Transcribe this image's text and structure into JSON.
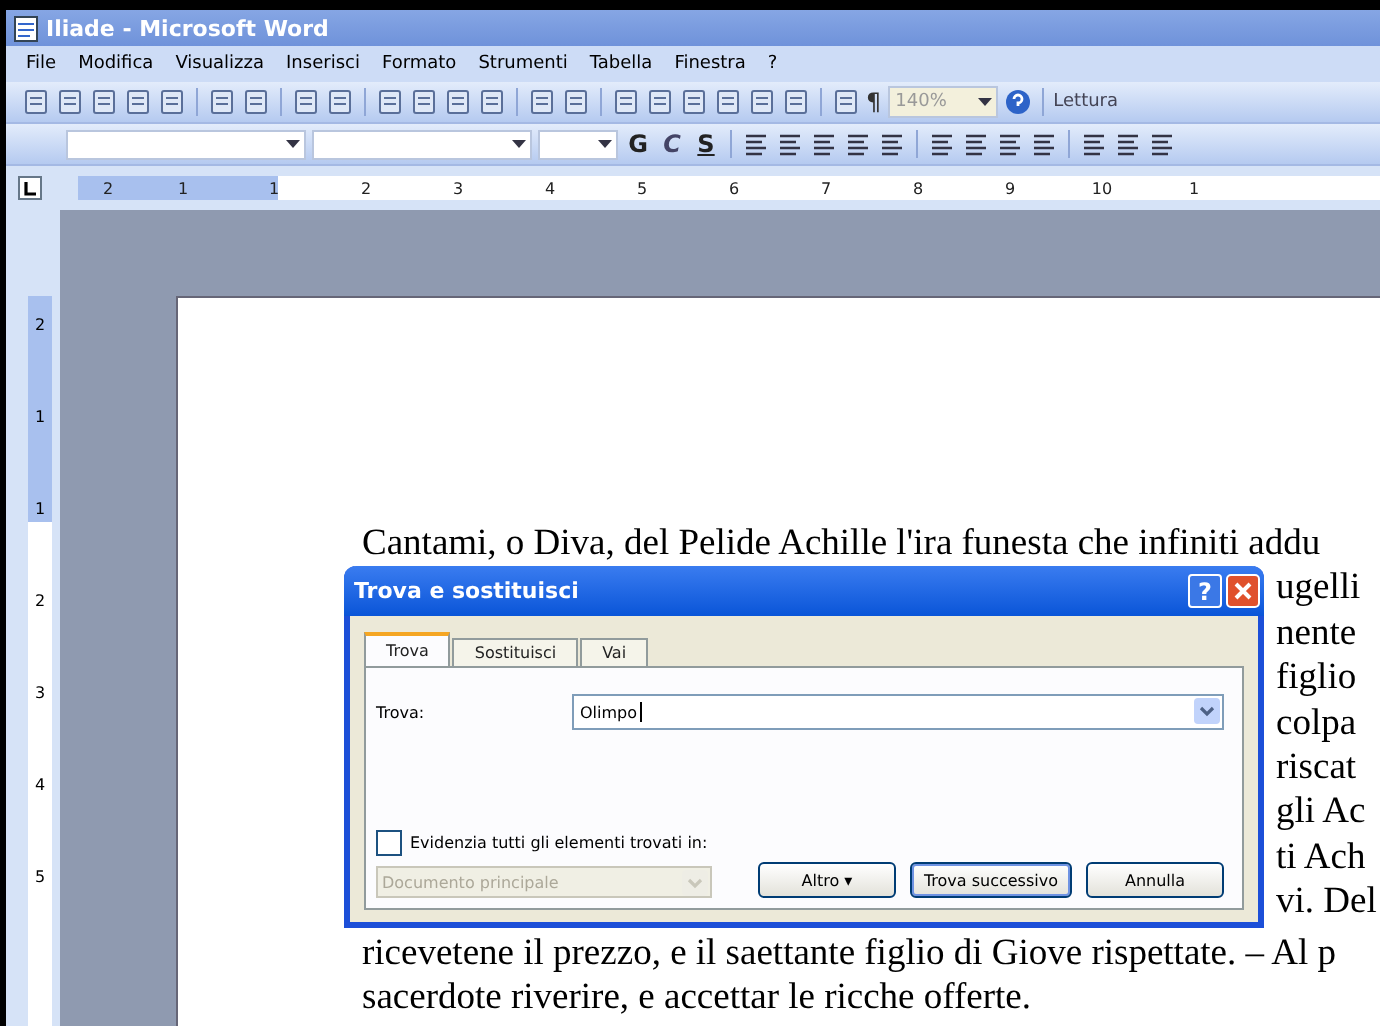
{
  "window": {
    "title": "Iliade - Microsoft Word"
  },
  "menu": [
    "File",
    "Modifica",
    "Visualizza",
    "Inserisci",
    "Formato",
    "Strumenti",
    "Tabella",
    "Finestra",
    "?"
  ],
  "toolbar": {
    "pilcrow": "¶",
    "zoom": "140%",
    "reading": "Lettura"
  },
  "format_toolbar": {
    "bold": "G",
    "italic": "C",
    "underline": "S"
  },
  "ruler": {
    "horizontal": [
      "2",
      "1",
      "1",
      "2",
      "3",
      "4",
      "5",
      "6",
      "7",
      "8",
      "9",
      "10",
      "1"
    ],
    "vertical": [
      "2",
      "1",
      "1",
      "2",
      "3",
      "4",
      "5"
    ]
  },
  "document": {
    "lines": [
      {
        "text": "Cantami, o Diva, del Pelide Achille l'ira funesta che infiniti addu",
        "kind": "full"
      },
      {
        "text": "ugelli",
        "kind": "fragment"
      },
      {
        "text": "nente",
        "kind": "fragment"
      },
      {
        "text": "figlio",
        "kind": "fragment"
      },
      {
        "text": "colpa",
        "kind": "fragment"
      },
      {
        "text": "riscat",
        "kind": "fragment"
      },
      {
        "text": "gli Ac",
        "kind": "fragment"
      },
      {
        "text": "ti Ach",
        "kind": "fragment"
      },
      {
        "text": "vi. Del",
        "kind": "fragment"
      },
      {
        "text": "ricevetene il prezzo, e il saettante figlio di Giove rispettate. – Al p",
        "kind": "full"
      },
      {
        "text": "sacerdote riverire, e accettar le ricche offerte.",
        "kind": "full"
      }
    ]
  },
  "dialog": {
    "title": "Trova e sostituisci",
    "help": "?",
    "tabs": [
      {
        "label": "Trova",
        "selected": true
      },
      {
        "label": "Sostituisci",
        "selected": false
      },
      {
        "label": "Vai",
        "selected": false
      }
    ],
    "find_label": "Trova:",
    "find_value": "Olimpo",
    "highlight": {
      "label": "Evidenzia tutti gli elementi trovati in:",
      "checked": false
    },
    "scope": {
      "value": "Documento principale",
      "disabled": true
    },
    "buttons": [
      {
        "label": "Altro ▾",
        "default": false
      },
      {
        "label": "Trova successivo",
        "default": true
      },
      {
        "label": "Annulla",
        "default": false
      }
    ]
  }
}
